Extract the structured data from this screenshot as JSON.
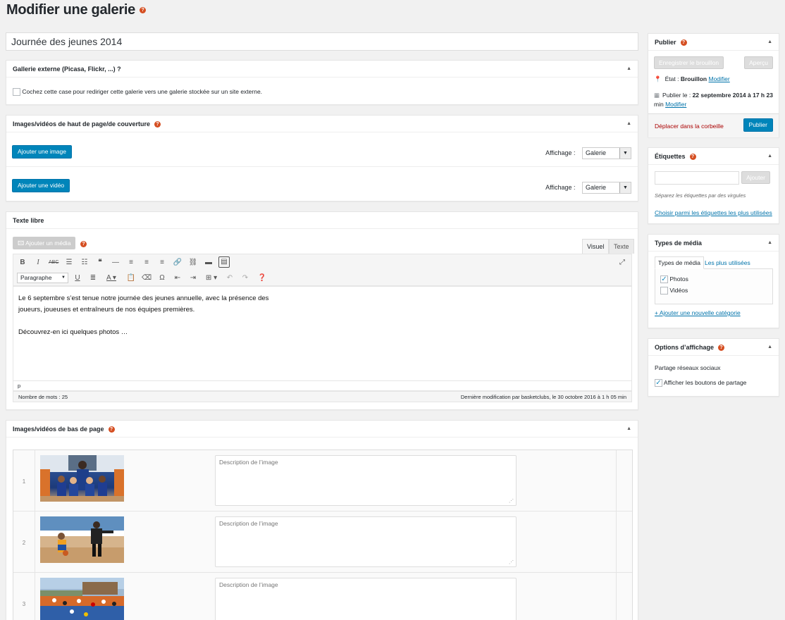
{
  "page": {
    "title": "Modifier une galerie",
    "help": "?"
  },
  "post_title": "Journée des jeunes 2014",
  "external_gallery": {
    "header": "Gallerie externe (Picasa, Flickr, ...) ?",
    "checkbox_label": "Cochez cette case pour rediriger cette galerie vers une galerie stockée sur un site externe."
  },
  "top_media": {
    "header": "Images/vidéos de haut de page/de couverture",
    "add_image": "Ajouter une image",
    "add_video": "Ajouter une vidéo",
    "display_label": "Affichage :",
    "display_value_1": "Galerie",
    "display_value_2": "Galerie"
  },
  "free_text": {
    "header": "Texte libre",
    "add_media": "Ajouter un média",
    "tab_visual": "Visuel",
    "tab_text": "Texte",
    "format": "Paragraphe",
    "content_line1": "Le 6 septembre s’est tenue notre journée des jeunes annuelle, avec la présence des",
    "content_line2": "joueurs, joueuses et entraîneurs de nos équipes premières.",
    "content_line3": "Découvrez-en ici quelques photos …",
    "path": "p",
    "word_count": "Nombre de mots : 25",
    "last_modified": "Dernière modification par basketclubs, le 30 octobre 2016 à 1 h 05 min"
  },
  "bottom_media": {
    "header": "Images/vidéos de bas de page",
    "rows": [
      {
        "num": "1",
        "placeholder": "Description de l’image"
      },
      {
        "num": "2",
        "placeholder": "Description de l’image"
      },
      {
        "num": "3",
        "placeholder": "Description de l’image"
      }
    ]
  },
  "publish": {
    "header": "Publier",
    "save_draft": "Enregistrer le brouillon",
    "preview": "Aperçu",
    "state_label": "État :",
    "state_value": "Brouillon",
    "modify": "Modifier",
    "publish_on": "Publier le :",
    "publish_date": "22 septembre 2014 à 17 h 23",
    "publish_date_end": "min",
    "modify2": "Modifier",
    "trash": "Déplacer dans la corbeille",
    "publish_btn": "Publier"
  },
  "tags": {
    "header": "Étiquettes",
    "add": "Ajouter",
    "hint": "Séparez les étiquettes par des virgules",
    "choose": "Choisir parmi les étiquettes les plus utilisées"
  },
  "media_types": {
    "header": "Types de média",
    "tab_all": "Types de média",
    "tab_popular": "Les plus utilisées",
    "item_photos": "Photos",
    "item_videos": "Vidéos",
    "add_category": "+ Ajouter une nouvelle catégorie"
  },
  "display_options": {
    "header": "Options d’affichage",
    "subtitle": "Partage réseaux sociaux",
    "share_label": "Afficher les boutons de partage"
  }
}
